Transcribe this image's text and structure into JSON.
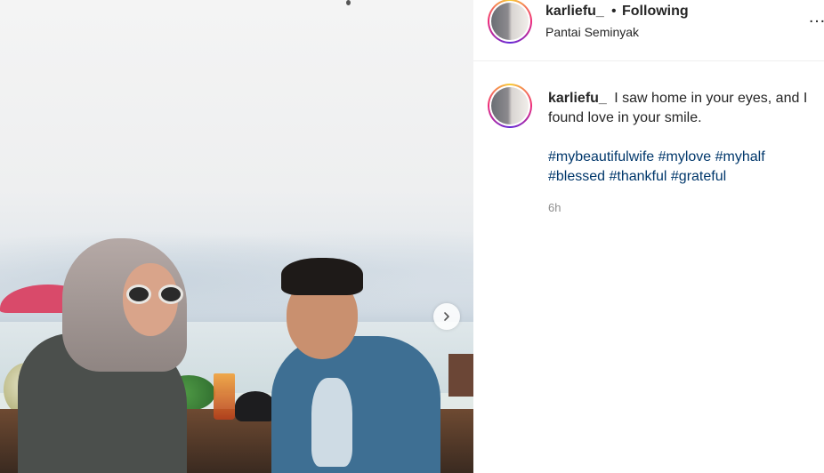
{
  "post": {
    "username": "karliefu_",
    "separator": "•",
    "follow_status": "Following",
    "location": "Pantai Seminyak",
    "more_icon": "…"
  },
  "caption": {
    "username": "karliefu_",
    "text": "I saw home in your eyes, and I found love in your smile.",
    "hashtags": [
      "#mybeautifulwife",
      "#mylove",
      "#myhalf",
      "#blessed",
      "#thankful",
      "#grateful"
    ],
    "time_ago": "6h"
  },
  "colors": {
    "hashtag": "#00376b",
    "text": "#262626",
    "muted": "#8e8e8e",
    "avatar_ring": [
      "#f9ce34",
      "#ee2a7b",
      "#6228d7"
    ]
  },
  "icons": {
    "next_arrow": "chevron-right-icon",
    "more": "more-horizontal-icon"
  }
}
